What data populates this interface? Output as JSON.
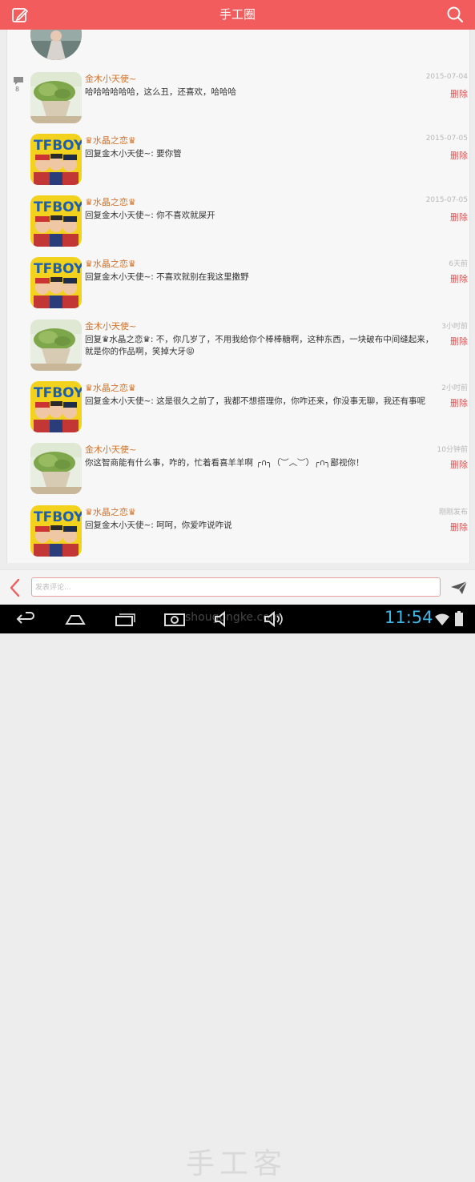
{
  "header": {
    "title": "手工圈"
  },
  "post": {
    "comment_count": "8"
  },
  "comments": [
    {
      "name": "金木小天使~",
      "time": "2015-07-04",
      "text": "哈哈哈哈哈哈，这么丑，还喜欢，哈哈哈",
      "delete": "删除",
      "avatar": "plant"
    },
    {
      "name": "♛水晶之恋♛",
      "time": "2015-07-05",
      "text": "回复金木小天使~: 要你管",
      "delete": "删除",
      "avatar": "tfboys"
    },
    {
      "name": "♛水晶之恋♛",
      "time": "2015-07-05",
      "text": "回复金木小天使~: 你不喜欢就屎开",
      "delete": "删除",
      "avatar": "tfboys"
    },
    {
      "name": "♛水晶之恋♛",
      "time": "6天前",
      "text": "回复金木小天使~: 不喜欢就别在我这里撒野",
      "delete": "删除",
      "avatar": "tfboys"
    },
    {
      "name": "金木小天使~",
      "time": "3小时前",
      "text": "回复♛水晶之恋♛: 不，你几岁了，不用我给你个棒棒糖啊，这种东西，一块破布中间缝起来，就是你的作品啊，笑掉大牙😝",
      "delete": "删除",
      "avatar": "plant"
    },
    {
      "name": "♛水晶之恋♛",
      "time": "2小时前",
      "text": "回复金木小天使~: 这是很久之前了，我都不想搭理你，你咋还来，你没事无聊，我还有事呢",
      "delete": "删除",
      "avatar": "tfboys"
    },
    {
      "name": "金木小天使~",
      "time": "10分钟前",
      "text": "你这智商能有什么事，咋的，忙着看喜羊羊啊 ╭∩╮（︶︿︶）╭∩╮鄙视你！",
      "delete": "删除",
      "avatar": "plant"
    },
    {
      "name": "♛水晶之恋♛",
      "time": "刚刚发布",
      "text": "回复金木小天使~: 呵呵，你爱咋说咋说",
      "delete": "删除",
      "avatar": "tfboys"
    }
  ],
  "composer": {
    "placeholder": "发表评论..."
  },
  "watermark": {
    "main": "手工客",
    "sub": "shougongke.com"
  },
  "statusbar": {
    "time": "11:54"
  },
  "colors": {
    "accent": "#f25c5c",
    "name": "#d4722a",
    "delete": "#e05353",
    "clock": "#3fb6e6"
  },
  "icons": [
    "edit-icon",
    "search-icon",
    "comment-icon",
    "back-icon",
    "send-icon",
    "nav-back-icon",
    "nav-home-icon",
    "nav-recent-icon",
    "screenshot-icon",
    "volume-down-icon",
    "volume-up-icon",
    "wifi-icon",
    "battery-icon"
  ]
}
